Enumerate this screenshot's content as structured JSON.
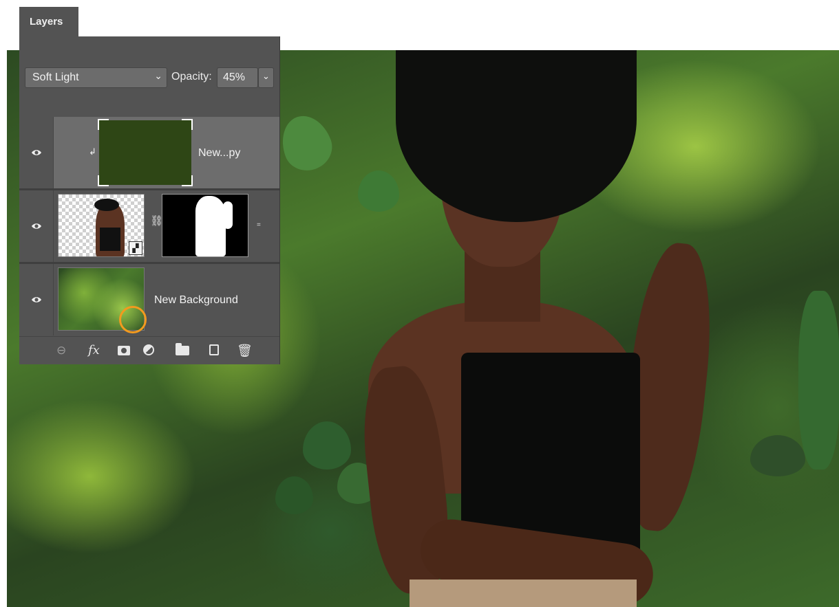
{
  "panel": {
    "tab_label": "Layers",
    "blend_mode": "Soft Light",
    "opacity_label": "Opacity:",
    "opacity_value": "45%"
  },
  "layers": [
    {
      "name": "New...py",
      "type": "solid-color-fill",
      "fill_color": "#2e4615",
      "visible": true,
      "selected": true,
      "clipped": true
    },
    {
      "name": "",
      "type": "smart-object-with-mask",
      "visible": true,
      "selected": false
    },
    {
      "name": "New Background",
      "type": "image",
      "visible": true,
      "selected": false
    }
  ],
  "toolbar": {
    "icons": [
      "link-layers-icon",
      "fx-icon",
      "add-mask-icon",
      "adjustment-layer-icon",
      "group-folder-icon",
      "new-layer-icon",
      "trash-icon"
    ],
    "fx_label": "fx",
    "highlighted": "adjustment-layer-icon",
    "highlight_color": "#f39a1e"
  }
}
